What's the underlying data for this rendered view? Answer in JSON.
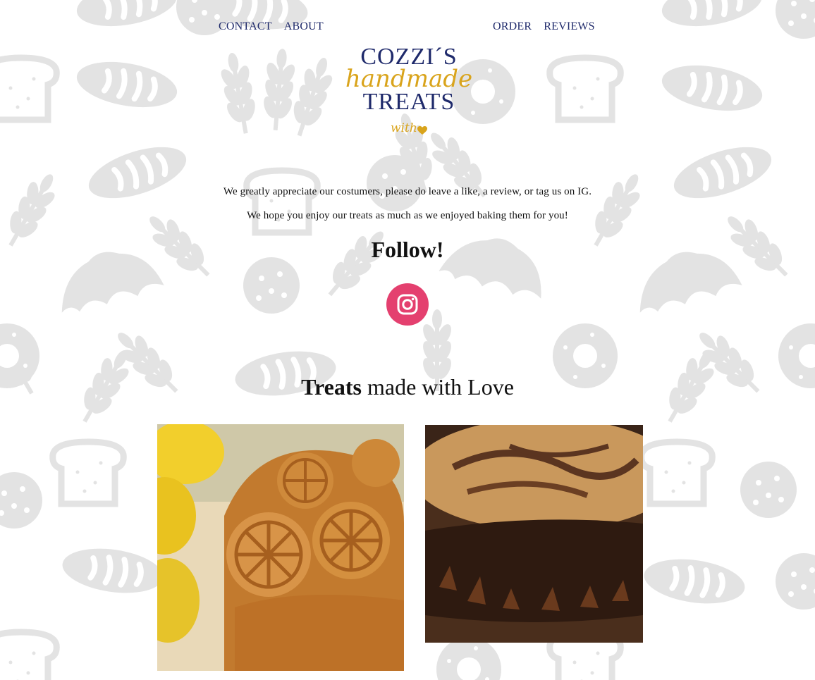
{
  "nav": {
    "contact": "CONTACT",
    "about": "ABOUT",
    "order": "ORDER",
    "reviews": "REVIEWS"
  },
  "logo": {
    "line1": "COZZI´S",
    "line2": "handmade",
    "line3": "TREATS",
    "line4": "with",
    "brand_navy": "#1f2a6b",
    "brand_gold": "#d9a41c"
  },
  "message": {
    "line1": "We greatly appreciate our costumers, please do leave a like, a review, or tag us on IG.",
    "line2": "We hope you enjoy our treats as much as we enjoyed baking them for you!"
  },
  "follow": {
    "heading": "Follow!",
    "icon": "instagram-icon",
    "icon_color": "#e4406f"
  },
  "treats": {
    "heading_bold": "Treats",
    "heading_rest": " made with Love",
    "photos": [
      {
        "subject": "lemon bundt cake with glaze and lemons"
      },
      {
        "subject": "marble cake with chocolate shards"
      }
    ]
  },
  "background": {
    "pattern": "bakery icons: bread loaves, toast slices, wheat stalks, croissants, bagels, cookies",
    "pattern_color": "#e3e3e3"
  }
}
